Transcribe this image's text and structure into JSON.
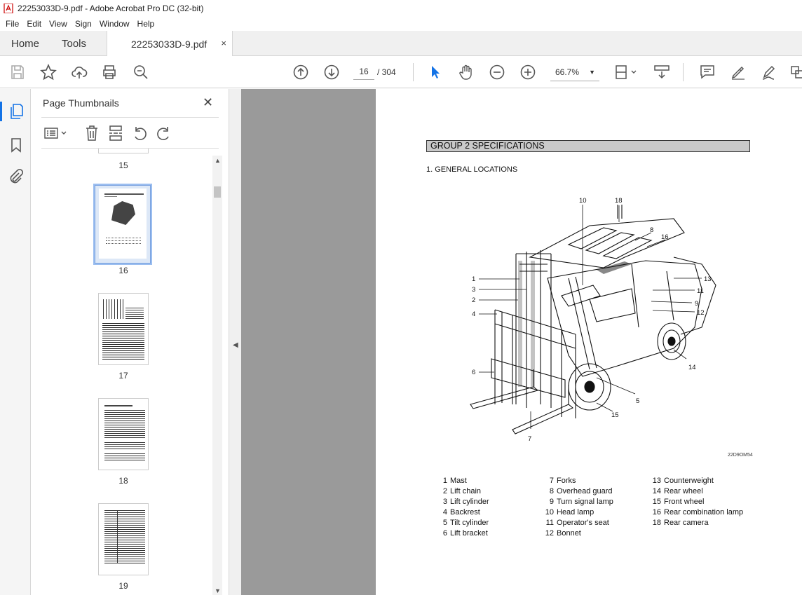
{
  "window": {
    "title": "22253033D-9.pdf - Adobe Acrobat Pro DC (32-bit)"
  },
  "menu": [
    "File",
    "Edit",
    "View",
    "Sign",
    "Window",
    "Help"
  ],
  "tabs": {
    "home": "Home",
    "tools": "Tools",
    "document": "22253033D-9.pdf",
    "close": "×"
  },
  "toolbar": {
    "current_page": "16",
    "total_pages": "/ 304",
    "zoom": "66.7%"
  },
  "panel": {
    "title": "Page Thumbnails",
    "thumbnails": [
      {
        "label": "15"
      },
      {
        "label": "16",
        "selected": true
      },
      {
        "label": "17"
      },
      {
        "label": "18"
      },
      {
        "label": "19"
      }
    ]
  },
  "document": {
    "group_title": "GROUP 2  SPECIFICATIONS",
    "section_title": "1. GENERAL LOCATIONS",
    "figure_code": "22D9OM54",
    "callouts": [
      "10",
      "18",
      "8",
      "16",
      "1",
      "3",
      "2",
      "4",
      "13",
      "11",
      "9",
      "12",
      "6",
      "14",
      "5",
      "15",
      "7"
    ],
    "legend": [
      {
        "num": "1",
        "label": "Mast"
      },
      {
        "num": "2",
        "label": "Lift chain"
      },
      {
        "num": "3",
        "label": "Lift cylinder"
      },
      {
        "num": "4",
        "label": "Backrest"
      },
      {
        "num": "5",
        "label": "Tilt cylinder"
      },
      {
        "num": "6",
        "label": "Lift bracket"
      },
      {
        "num": "7",
        "label": "Forks"
      },
      {
        "num": "8",
        "label": "Overhead guard"
      },
      {
        "num": "9",
        "label": "Turn signal lamp"
      },
      {
        "num": "10",
        "label": "Head lamp"
      },
      {
        "num": "11",
        "label": "Operator's seat"
      },
      {
        "num": "12",
        "label": "Bonnet"
      },
      {
        "num": "13",
        "label": "Counterweight"
      },
      {
        "num": "14",
        "label": "Rear wheel"
      },
      {
        "num": "15",
        "label": "Front wheel"
      },
      {
        "num": "16",
        "label": "Rear combination lamp"
      },
      {
        "num": "18",
        "label": "Rear camera"
      }
    ]
  }
}
